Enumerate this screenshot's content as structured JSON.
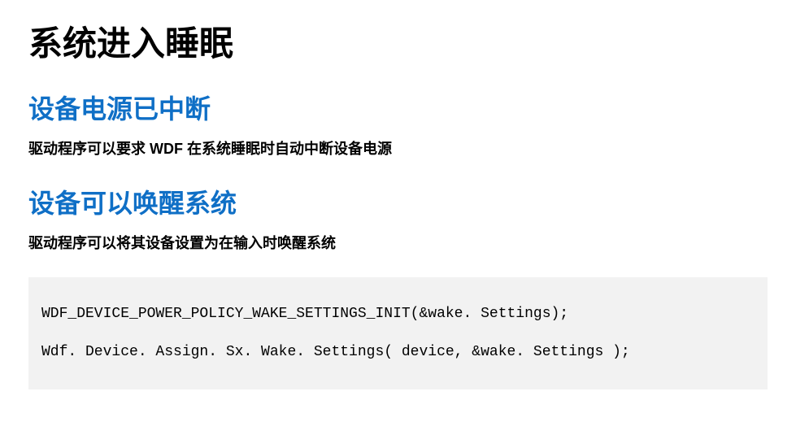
{
  "title": "系统进入睡眠",
  "sections": [
    {
      "heading": "设备电源已中断",
      "desc": "驱动程序可以要求 WDF 在系统睡眠时自动中断设备电源"
    },
    {
      "heading": "设备可以唤醒系统",
      "desc": "驱动程序可以将其设备设置为在输入时唤醒系统"
    }
  ],
  "code": {
    "line1": "WDF_DEVICE_POWER_POLICY_WAKE_SETTINGS_INIT(&wake. Settings);",
    "line2": "Wdf. Device. Assign. Sx. Wake. Settings( device, &wake. Settings );"
  }
}
